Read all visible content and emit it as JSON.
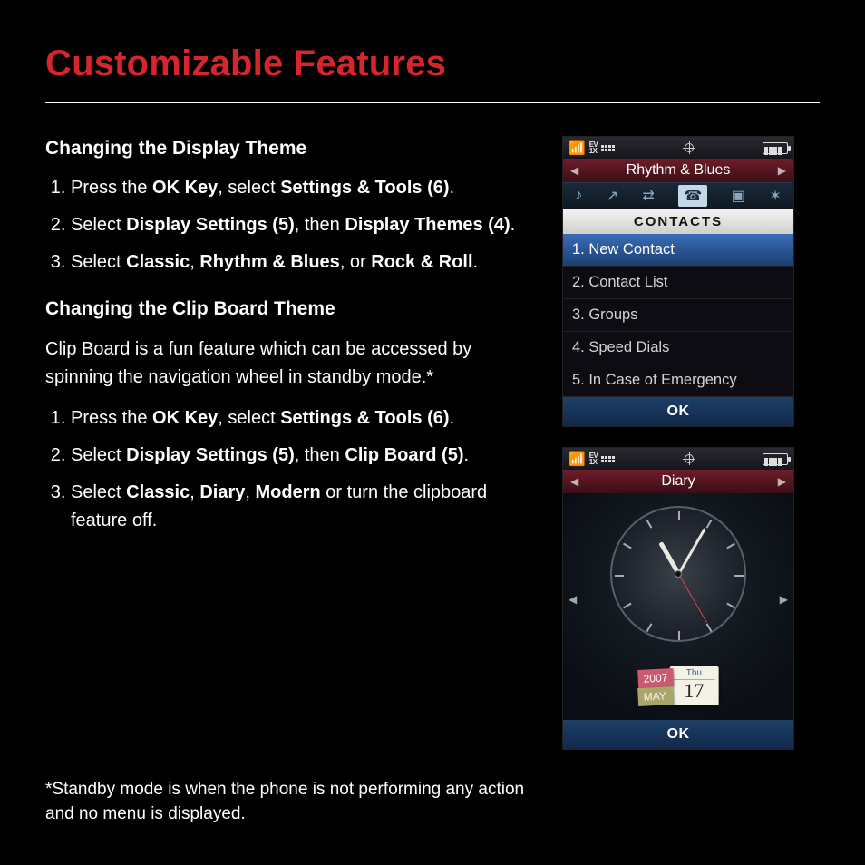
{
  "title": "Customizable Features",
  "section1": {
    "heading": "Changing the Display Theme",
    "step1_a": "Press the ",
    "step1_b": "OK Key",
    "step1_c": ", select ",
    "step1_d": "Settings & Tools (6)",
    "step1_e": ".",
    "step2_a": "Select ",
    "step2_b": "Display Settings (5)",
    "step2_c": ", then ",
    "step2_d": "Display Themes (4)",
    "step2_e": ".",
    "step3_a": "Select ",
    "step3_b": "Classic",
    "step3_c": ", ",
    "step3_d": "Rhythm & Blues",
    "step3_e": ", or ",
    "step3_f": "Rock & Roll",
    "step3_g": "."
  },
  "section2": {
    "heading": "Changing the Clip Board Theme",
    "intro": "Clip Board is a fun feature which can be accessed by spinning the navigation wheel in standby mode.*",
    "step1_a": "Press the ",
    "step1_b": "OK Key",
    "step1_c": ", select ",
    "step1_d": "Settings & Tools (6)",
    "step1_e": ".",
    "step2_a": "Select ",
    "step2_b": "Display Settings (5)",
    "step2_c": ", then ",
    "step2_d": "Clip Board (5)",
    "step2_e": ".",
    "step3_a": "Select ",
    "step3_b": "Classic",
    "step3_c": ", ",
    "step3_d": "Diary",
    "step3_e": ", ",
    "step3_f": "Modern",
    "step3_g": " or turn the clipboard feature off."
  },
  "footnote": "*Standby mode is when the phone is not performing any action and no menu is displayed.",
  "screenA": {
    "theme": "Rhythm & Blues",
    "section": "CONTACTS",
    "menu": [
      "1.  New Contact",
      "2. Contact List",
      "3. Groups",
      "4. Speed Dials",
      "5. In Case of  Emergency"
    ],
    "softkey": "OK",
    "status": {
      "evdo_top": "EV",
      "evdo_bot": "1X"
    }
  },
  "screenB": {
    "title": "Diary",
    "year": "2007",
    "month": "MAY",
    "dow": "Thu",
    "day": "17",
    "softkey": "OK",
    "status": {
      "evdo_top": "EV",
      "evdo_bot": "1X"
    }
  }
}
